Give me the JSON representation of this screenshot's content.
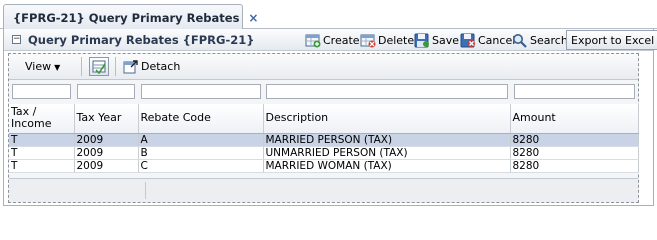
{
  "tab": {
    "title": "{FPRG-21} Query Primary Rebates",
    "close_glyph": "×"
  },
  "panel": {
    "title": "Query Primary Rebates {FPRG-21}",
    "collapse_glyph": "−",
    "actions": {
      "create": "Create",
      "delete": "Delete",
      "save": "Save",
      "cancel": "Cancel",
      "search": "Search",
      "export": "Export to Excel"
    }
  },
  "toolbar": {
    "view_label": "View",
    "view_caret": "▼",
    "detach_label": "Detach"
  },
  "table": {
    "columns": [
      "Tax / Income",
      "Tax Year",
      "Rebate Code",
      "Description",
      "Amount"
    ],
    "rows": [
      [
        "T",
        "2009",
        "A",
        "MARRIED PERSON (TAX)",
        "8280"
      ],
      [
        "T",
        "2009",
        "B",
        "UNMARRIED PERSON (TAX)",
        "8280"
      ],
      [
        "T",
        "2009",
        "C",
        "MARRIED WOMAN (TAX)",
        "8280"
      ]
    ],
    "selected_row": 0
  },
  "colors": {
    "accent": "#3f67a3",
    "selected_row": "#c8d3e6",
    "header_bg": "#e6eaef"
  },
  "icons": [
    "close-icon",
    "collapse-icon",
    "create-icon",
    "delete-icon",
    "save-icon",
    "cancel-icon",
    "search-icon",
    "grid-settings-icon",
    "detach-icon",
    "chevron-down-icon"
  ]
}
